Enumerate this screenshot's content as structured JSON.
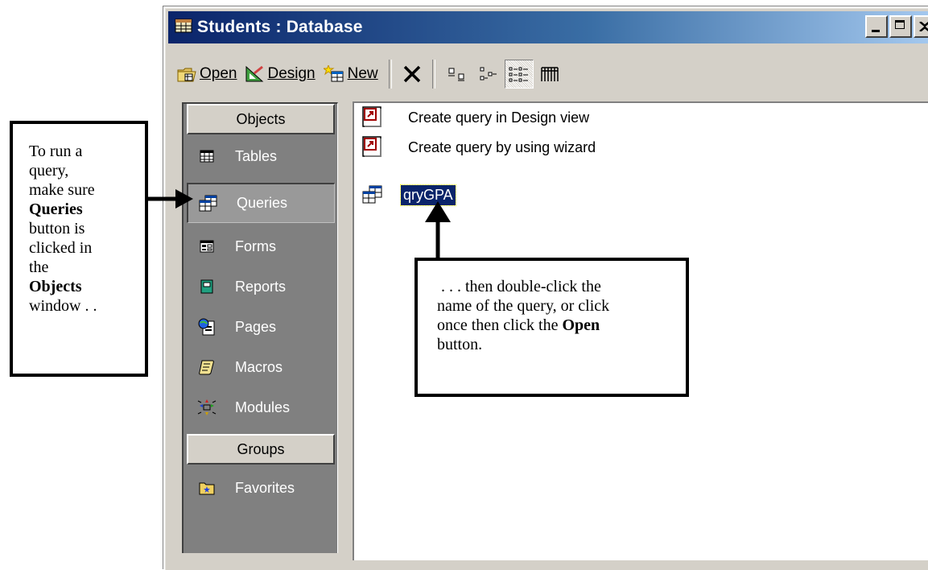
{
  "window": {
    "title": "Students : Database",
    "title_gradient_start": "#0a246a",
    "title_gradient_end": "#a6caf0"
  },
  "toolbar": {
    "open_label": "Open",
    "design_label": "Design",
    "new_label": "New",
    "view_buttons": [
      "large-icons-view",
      "small-icons-view",
      "list-view",
      "details-view"
    ],
    "active_view": "list-view"
  },
  "sidebar": {
    "objects_header": "Objects",
    "items": [
      {
        "label": "Tables",
        "icon": "table-icon"
      },
      {
        "label": "Queries",
        "icon": "query-icon",
        "selected": true
      },
      {
        "label": "Forms",
        "icon": "form-icon"
      },
      {
        "label": "Reports",
        "icon": "report-icon"
      },
      {
        "label": "Pages",
        "icon": "page-icon"
      },
      {
        "label": "Macros",
        "icon": "macro-icon"
      },
      {
        "label": "Modules",
        "icon": "module-icon"
      }
    ],
    "groups_header": "Groups",
    "groups": [
      {
        "label": "Favorites",
        "icon": "favorites-folder-icon"
      }
    ]
  },
  "list": {
    "items": [
      {
        "label": "Create query in Design view",
        "icon": "shortcut-icon"
      },
      {
        "label": "Create query by using wizard",
        "icon": "shortcut-icon"
      },
      {
        "label": "qryGPA",
        "icon": "query-icon",
        "selected": true
      }
    ],
    "selection_color": "#0a246a"
  },
  "callouts": {
    "left": {
      "l1": "To run a",
      "l2": "query,",
      "l3": "make sure",
      "l4": "Queries",
      "l5": "button is",
      "l6": "clicked in",
      "l7": "the",
      "l8": "Objects",
      "l9": "window . ."
    },
    "right": {
      "l1": " . . . then double-click the",
      "l2": "name of the query, or click",
      "l3": "once then click the ",
      "l3_bold": "Open",
      "l4": "button."
    }
  }
}
